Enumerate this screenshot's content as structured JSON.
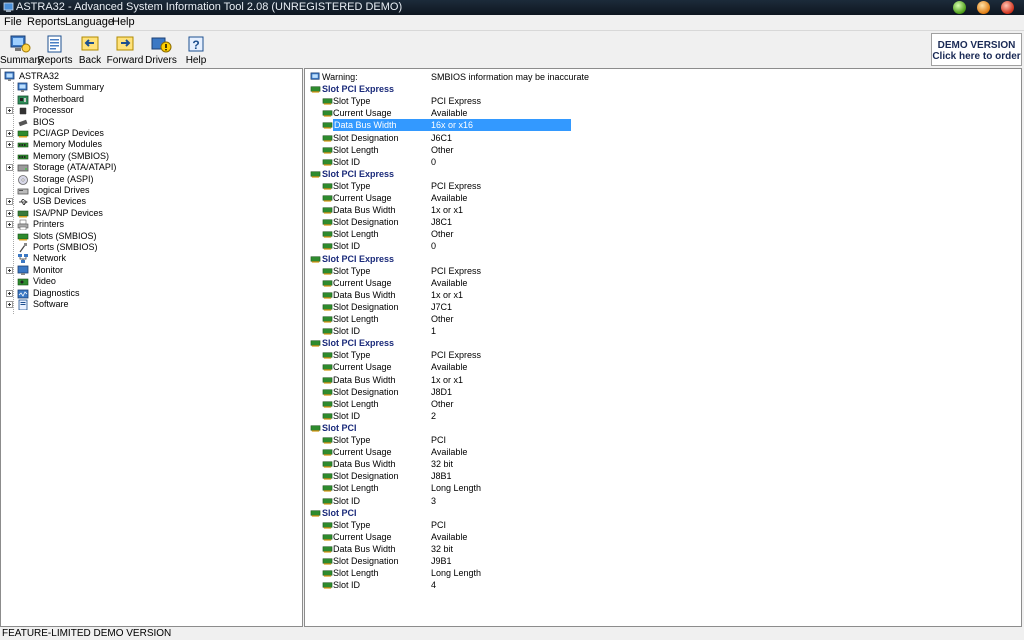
{
  "window": {
    "title": "ASTRA32 - Advanced System Information Tool 2.08 (UNREGISTERED DEMO)"
  },
  "menu": [
    "File",
    "Reports",
    "Language",
    "Help"
  ],
  "toolbar": [
    "Summary",
    "Reports",
    "Back",
    "Forward",
    "Drivers",
    "Help"
  ],
  "demo": {
    "line1": "DEMO VERSION",
    "line2": "Click here to order"
  },
  "tree": {
    "root": "ASTRA32",
    "items": [
      {
        "label": "System Summary",
        "expandable": false,
        "icon": "computer-icon"
      },
      {
        "label": "Motherboard",
        "expandable": false,
        "icon": "motherboard-icon"
      },
      {
        "label": "Processor",
        "expandable": true,
        "icon": "processor-icon"
      },
      {
        "label": "BIOS",
        "expandable": false,
        "icon": "bios-chip-icon"
      },
      {
        "label": "PCI/AGP Devices",
        "expandable": true,
        "icon": "pci-card-icon"
      },
      {
        "label": "Memory Modules",
        "expandable": true,
        "icon": "memory-icon"
      },
      {
        "label": "Memory (SMBIOS)",
        "expandable": false,
        "icon": "memory-icon"
      },
      {
        "label": "Storage (ATA/ATAPI)",
        "expandable": true,
        "icon": "hard-drive-icon"
      },
      {
        "label": "Storage (ASPI)",
        "expandable": false,
        "icon": "cd-drive-icon"
      },
      {
        "label": "Logical Drives",
        "expandable": false,
        "icon": "logical-drive-icon"
      },
      {
        "label": "USB Devices",
        "expandable": true,
        "icon": "usb-icon"
      },
      {
        "label": "ISA/PNP Devices",
        "expandable": true,
        "icon": "isa-card-icon"
      },
      {
        "label": "Printers",
        "expandable": true,
        "icon": "printer-icon"
      },
      {
        "label": "Slots (SMBIOS)",
        "expandable": false,
        "icon": "slot-icon"
      },
      {
        "label": "Ports (SMBIOS)",
        "expandable": false,
        "icon": "port-icon"
      },
      {
        "label": "Network",
        "expandable": false,
        "icon": "network-icon"
      },
      {
        "label": "Monitor",
        "expandable": true,
        "icon": "monitor-icon"
      },
      {
        "label": "Video",
        "expandable": false,
        "icon": "video-icon"
      },
      {
        "label": "Diagnostics",
        "expandable": true,
        "icon": "diagnostics-icon"
      },
      {
        "label": "Software",
        "expandable": true,
        "icon": "software-icon"
      }
    ]
  },
  "detail": {
    "warning": {
      "label": "Warning:",
      "value": "SMBIOS information may be inaccurate"
    },
    "field_labels": [
      "Slot Type",
      "Current Usage",
      "Data Bus Width",
      "Slot Designation",
      "Slot Length",
      "Slot ID"
    ],
    "selected": {
      "section": 0,
      "field": 2
    },
    "sections": [
      {
        "title": "Slot PCI Express",
        "values": [
          "PCI Express",
          "Available",
          "16x or x16",
          "J6C1",
          "Other",
          "0"
        ]
      },
      {
        "title": "Slot PCI Express",
        "values": [
          "PCI Express",
          "Available",
          "1x or x1",
          "J8C1",
          "Other",
          "0"
        ]
      },
      {
        "title": "Slot PCI Express",
        "values": [
          "PCI Express",
          "Available",
          "1x or x1",
          "J7C1",
          "Other",
          "1"
        ]
      },
      {
        "title": "Slot PCI Express",
        "values": [
          "PCI Express",
          "Available",
          "1x or x1",
          "J8D1",
          "Other",
          "2"
        ]
      },
      {
        "title": "Slot PCI",
        "values": [
          "PCI",
          "Available",
          "32 bit",
          "J8B1",
          "Long Length",
          "3"
        ]
      },
      {
        "title": "Slot PCI",
        "values": [
          "PCI",
          "Available",
          "32 bit",
          "J9B1",
          "Long Length",
          "4"
        ]
      }
    ]
  },
  "status": "FEATURE-LIMITED DEMO VERSION",
  "colors": {
    "selection": "#3399ff",
    "section_title": "#1a2a7a",
    "slot_icon": "#2e8b2e"
  }
}
